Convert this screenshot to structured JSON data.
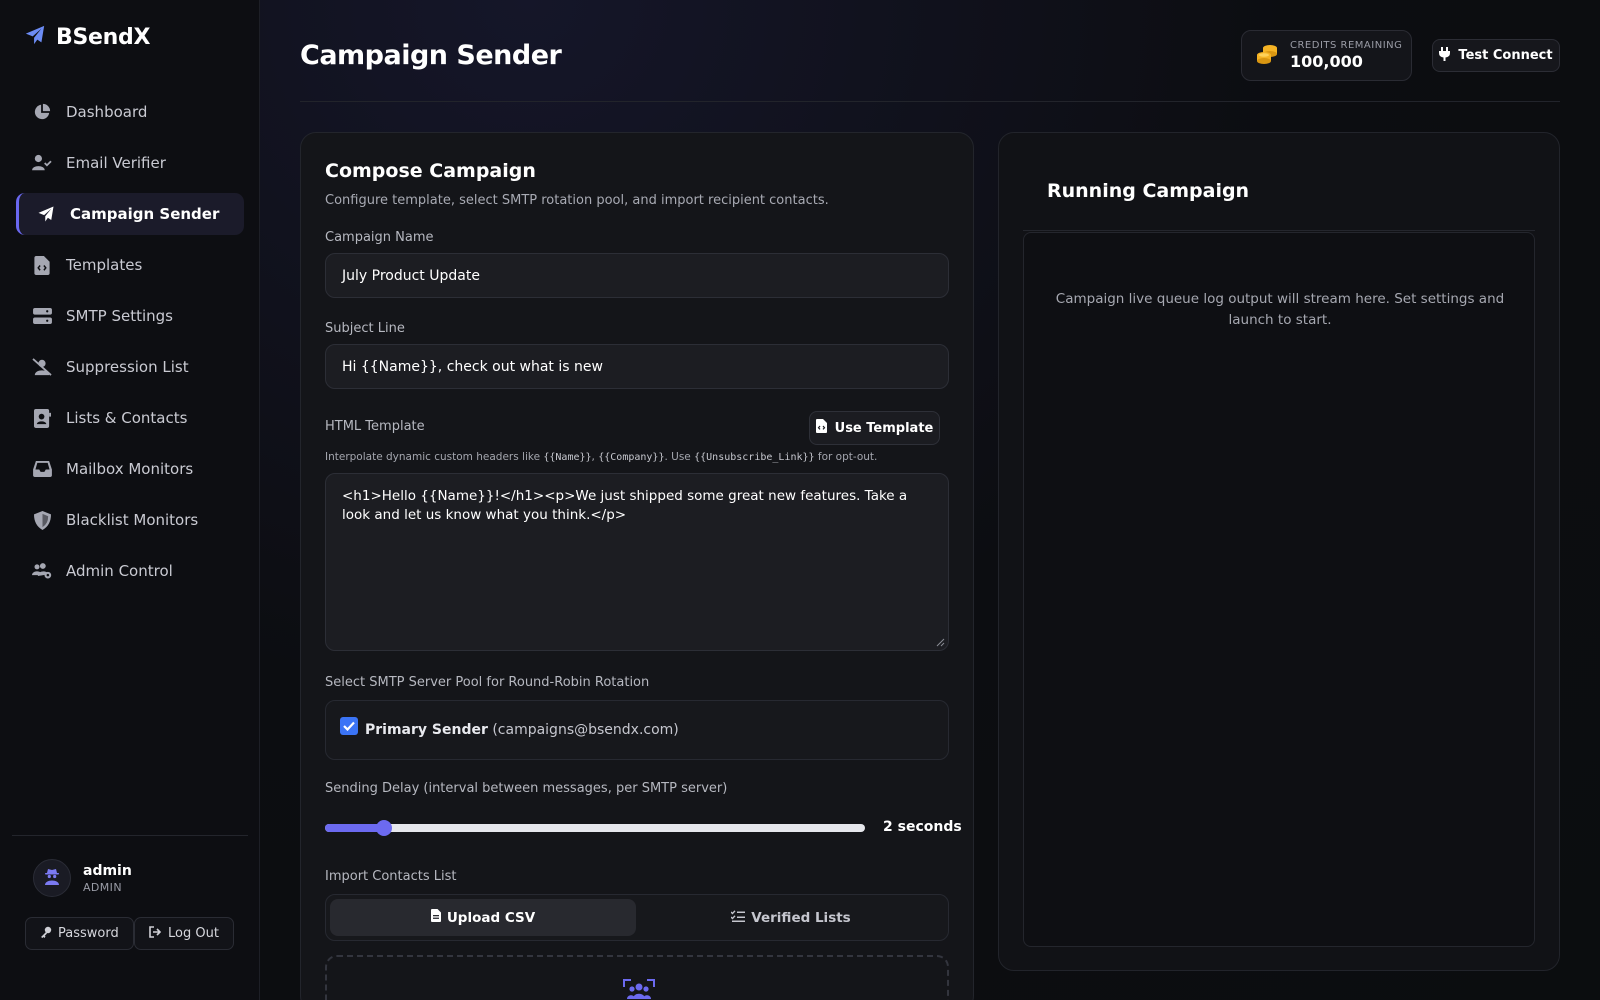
{
  "brand": {
    "name": "BSendX"
  },
  "sidebar": {
    "items": [
      {
        "label": "Dashboard",
        "icon": "chart-pie-icon"
      },
      {
        "label": "Email Verifier",
        "icon": "user-check-icon"
      },
      {
        "label": "Campaign Sender",
        "icon": "paper-plane-icon",
        "active": true
      },
      {
        "label": "Templates",
        "icon": "file-code-icon"
      },
      {
        "label": "SMTP Settings",
        "icon": "server-icon"
      },
      {
        "label": "Suppression List",
        "icon": "user-slash-icon"
      },
      {
        "label": "Lists & Contacts",
        "icon": "address-book-icon"
      },
      {
        "label": "Mailbox Monitors",
        "icon": "inbox-icon"
      },
      {
        "label": "Blacklist Monitors",
        "icon": "shield-icon"
      },
      {
        "label": "Admin Control",
        "icon": "users-gear-icon"
      }
    ],
    "user": {
      "name": "admin",
      "role": "ADMIN"
    },
    "password_label": "Password",
    "logout_label": "Log Out"
  },
  "header": {
    "title": "Campaign Sender",
    "credits_label": "CREDITS REMAINING",
    "credits_value": "100,000",
    "test_connect_label": "Test Connect"
  },
  "compose": {
    "title": "Compose Campaign",
    "description": "Configure template, select SMTP rotation pool, and import recipient contacts.",
    "campaign_name_label": "Campaign Name",
    "campaign_name_value": "July Product Update",
    "subject_label": "Subject Line",
    "subject_value": "Hi {{Name}}, check out what is new",
    "html_template_label": "HTML Template",
    "use_template_label": "Use Template",
    "hint_prefix": "Interpolate dynamic custom headers like ",
    "hint_name_tag": "{{Name}}",
    "hint_sep": ", ",
    "hint_company_tag": "{{Company}}",
    "hint_mid": ". Use ",
    "hint_unsub_tag": "{{Unsubscribe_Link}}",
    "hint_suffix": " for opt-out.",
    "html_template_value": "<h1>Hello {{Name}}!</h1><p>We just shipped some great new features. Take a look and let us know what you think.</p>",
    "smtp_pool_label": "Select SMTP Server Pool for Round-Robin Rotation",
    "smtp_server_name": "Primary Sender",
    "smtp_server_email": "(campaigns@bsendx.com)",
    "smtp_server_checked": true,
    "delay_label": "Sending Delay (interval between messages, per SMTP server)",
    "delay_fraction": 0.11,
    "delay_value_text": "2 seconds",
    "import_label": "Import Contacts List",
    "tab_upload": "Upload CSV",
    "tab_verified": "Verified Lists"
  },
  "running": {
    "title": "Running Campaign",
    "log_placeholder": "Campaign live queue log output will stream here. Set settings and launch to start."
  },
  "colors": {
    "accent": "#6c6af0",
    "checkbox": "#3b74f6",
    "credits_coin": "#f5b324"
  }
}
